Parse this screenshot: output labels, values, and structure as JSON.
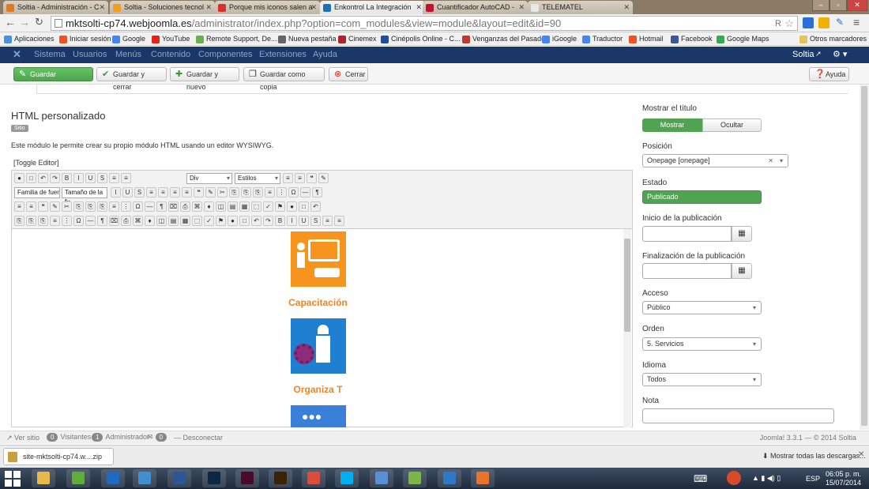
{
  "browser": {
    "tabs": [
      {
        "label": "Soltia - Administración - C",
        "color": "#e07a1f",
        "active": false
      },
      {
        "label": "Soltia - Soluciones tecnol",
        "color": "#f0a020",
        "active": false
      },
      {
        "label": "Porque mis iconos salen a",
        "color": "#d9302c",
        "active": false
      },
      {
        "label": "Enkontrol La Integración",
        "color": "#1e6fb8",
        "active": true
      },
      {
        "label": "Cuantificador AutoCAD -",
        "color": "#c8102e",
        "active": false
      },
      {
        "label": "TELEMATEL",
        "color": "#e8e8e8",
        "active": false
      }
    ],
    "url_host": "mktsolti-cp74.webjoomla.es",
    "url_path": "/administrator/index.php?option=com_modules&view=module&layout=edit&id=90",
    "bookmarks": [
      {
        "label": "Aplicaciones",
        "color": "#4a90e2"
      },
      {
        "label": "Iniciar sesión",
        "color": "#f25022"
      },
      {
        "label": "Google",
        "color": "#4285f4"
      },
      {
        "label": "YouTube",
        "color": "#e62117"
      },
      {
        "label": "Remote Support, De...",
        "color": "#6ab04c"
      },
      {
        "label": "Nueva pestaña",
        "color": "#666666"
      },
      {
        "label": "Cinemex",
        "color": "#b0232a"
      },
      {
        "label": "Cinépolis Online - C...",
        "color": "#1f4e9a"
      },
      {
        "label": "Venganzas del Pasado",
        "color": "#c0392b"
      },
      {
        "label": "iGoogle",
        "color": "#4285f4"
      },
      {
        "label": "Traductor",
        "color": "#4285f4"
      },
      {
        "label": "Hotmail",
        "color": "#f25022"
      },
      {
        "label": "Facebook",
        "color": "#3b5998"
      },
      {
        "label": "Google Maps",
        "color": "#34a853"
      }
    ],
    "bookmarks_other": "Otros marcadores"
  },
  "joomla": {
    "menu": [
      "Sistema",
      "Usuarios",
      "Menús",
      "Contenido",
      "Componentes",
      "Extensiones",
      "Ayuda"
    ],
    "user": "Soltia",
    "toolbar": {
      "save": "Guardar",
      "save_close": "Guardar y cerrar",
      "save_new": "Guardar y nuevo",
      "save_copy": "Guardar como copia",
      "close": "Cerrar",
      "help": "Ayuda"
    },
    "module": {
      "title": "HTML personalizado",
      "badge": "Sitio",
      "description": "Este módulo le permite crear su propio módulo HTML usando un editor WYSIWYG.",
      "toggle_editor": "[Toggle Editor]"
    },
    "editor": {
      "format_select": "Div",
      "styles_select": "Estilos",
      "font_family": "Familia de fuer",
      "font_size": "Tamaño de la fu",
      "items": [
        {
          "caption": "Capacitación",
          "color": "#f5821f"
        },
        {
          "caption": "Organiza T",
          "color": "#f5821f"
        }
      ]
    },
    "sidebar": {
      "show_title_label": "Mostrar el título",
      "show_btn": "Mostrar",
      "hide_btn": "Ocultar",
      "position_label": "Posición",
      "position_value": "Onepage [onepage]",
      "status_label": "Estado",
      "status_value": "Publicado",
      "publish_up_label": "Inicio de la publicación",
      "publish_down_label": "Finalización de la publicación",
      "access_label": "Acceso",
      "access_value": "Público",
      "order_label": "Orden",
      "order_value": "5. Servicios",
      "language_label": "Idioma",
      "language_value": "Todos",
      "note_label": "Nota"
    },
    "status_bar": {
      "view_site": "Ver sitio",
      "visitors_count": "0",
      "visitors": "Visitantes",
      "admin_count": "1",
      "admin": "Administrador",
      "logout_count": "0",
      "logout": "Desconectar",
      "version": "Joomla! 3.3.1 — © 2014 Soltia"
    }
  },
  "downloads": {
    "file": "site-mktsolti-cp74.w....zip",
    "show_all": "Mostrar todas las descargas..."
  },
  "taskbar": {
    "lang": "ESP",
    "time": "06:05 p. m.",
    "date": "15/07/2014",
    "apps": [
      {
        "name": "explorer",
        "color": "#e8b84a"
      },
      {
        "name": "grid",
        "color": "#5fae3c"
      },
      {
        "name": "outlook",
        "color": "#1f6bc4"
      },
      {
        "name": "paint",
        "color": "#3f8fd1"
      },
      {
        "name": "word",
        "color": "#2b5797"
      },
      {
        "name": "photoshop",
        "color": "#0d2740"
      },
      {
        "name": "indesign",
        "color": "#4b0a2a"
      },
      {
        "name": "illustrator",
        "color": "#3a2204"
      },
      {
        "name": "chrome",
        "color": "#dd4b39"
      },
      {
        "name": "skype",
        "color": "#00aff0"
      },
      {
        "name": "app",
        "color": "#5a8ed8"
      },
      {
        "name": "project",
        "color": "#7ab648"
      },
      {
        "name": "imageviewer",
        "color": "#2f78c8"
      },
      {
        "name": "media",
        "color": "#e8742c"
      }
    ]
  },
  "colors": {
    "joomla_header": "#1a3867",
    "green": "#51a351",
    "tile_orange": "#f7941d",
    "tile_blue": "#1f7fd1"
  }
}
